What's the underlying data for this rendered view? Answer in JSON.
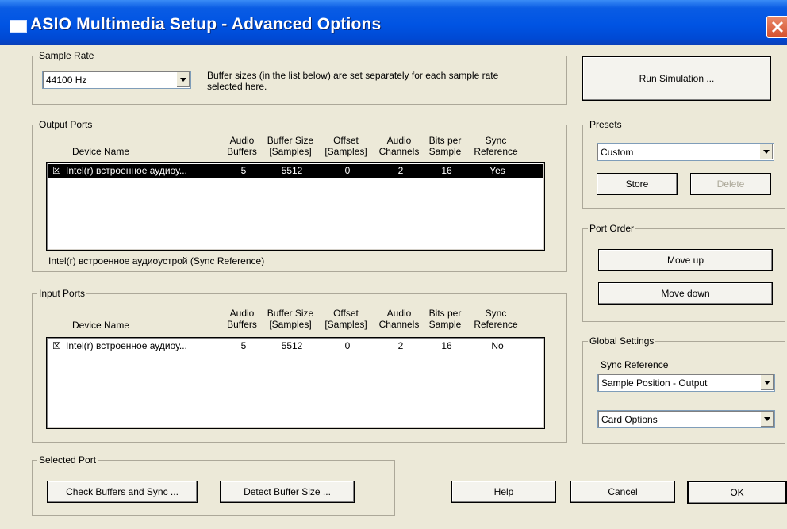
{
  "window": {
    "title": "ASIO Multimedia Setup  - Advanced Options"
  },
  "sample_rate": {
    "group_label": "Sample Rate",
    "selected": "44100 Hz",
    "note_line1": "Buffer sizes (in the list below) are set separately for each sample rate",
    "note_line2": "selected here."
  },
  "columns": {
    "device_name": "Device Name",
    "audio_buffers": [
      "Audio",
      "Buffers"
    ],
    "buffer_size": [
      "Buffer Size",
      "[Samples]"
    ],
    "offset": [
      "Offset",
      "[Samples]"
    ],
    "audio_channels": [
      "Audio",
      "Channels"
    ],
    "bits_per_sample": [
      "Bits per",
      "Sample"
    ],
    "sync_reference": [
      "Sync",
      "Reference"
    ]
  },
  "output_ports": {
    "group_label": "Output Ports",
    "rows": [
      {
        "checked": "☒",
        "device": "Intel(r) встроенное аудиоу...",
        "buffers": "5",
        "buffer_size": "5512",
        "offset": "0",
        "channels": "2",
        "bits": "16",
        "sync": "Yes"
      }
    ],
    "status": "Intel(r) встроенное аудиоустрой (Sync Reference)"
  },
  "input_ports": {
    "group_label": "Input Ports",
    "rows": [
      {
        "checked": "☒",
        "device": "Intel(r) встроенное аудиоу...",
        "buffers": "5",
        "buffer_size": "5512",
        "offset": "0",
        "channels": "2",
        "bits": "16",
        "sync": "No"
      }
    ]
  },
  "selected_port": {
    "group_label": "Selected Port",
    "check_buffers": "Check Buffers and Sync ...",
    "detect_buffer": "Detect Buffer Size ..."
  },
  "run_simulation": "Run Simulation ...",
  "presets": {
    "group_label": "Presets",
    "selected": "Custom",
    "store": "Store",
    "delete": "Delete"
  },
  "port_order": {
    "group_label": "Port Order",
    "move_up": "Move up",
    "move_down": "Move down"
  },
  "global_settings": {
    "group_label": "Global Settings",
    "sync_label": "Sync Reference",
    "sync_selected": "Sample Position - Output",
    "card_options": "Card Options"
  },
  "footer": {
    "help": "Help",
    "cancel": "Cancel",
    "ok": "OK"
  }
}
